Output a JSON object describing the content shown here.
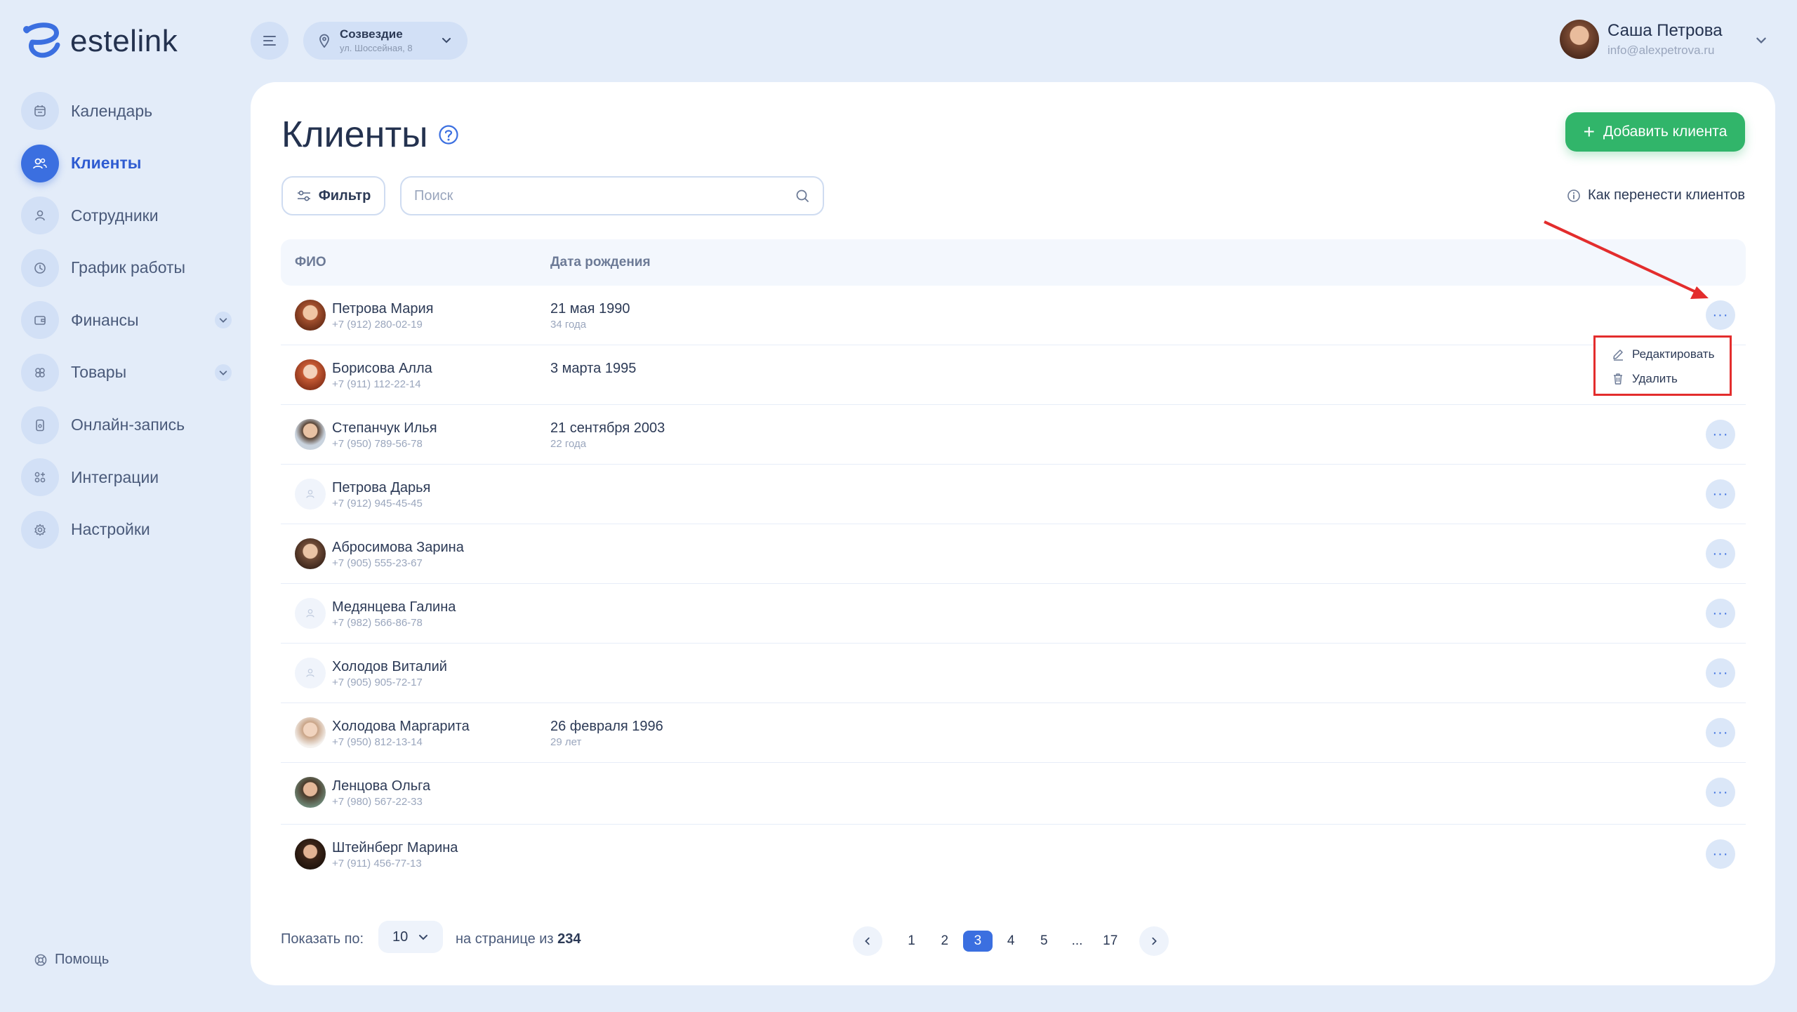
{
  "brand": {
    "name": "estelink"
  },
  "location": {
    "name": "Созвездие",
    "address": "ул. Шоссейная, 8"
  },
  "user": {
    "name": "Саша Петрова",
    "email": "info@alexpetrova.ru"
  },
  "sidebar": {
    "items": [
      {
        "label": "Календарь",
        "icon": "calendar-icon"
      },
      {
        "label": "Клиенты",
        "icon": "clients-icon",
        "active": true
      },
      {
        "label": "Сотрудники",
        "icon": "employee-icon"
      },
      {
        "label": "График работы",
        "icon": "clock-icon"
      },
      {
        "label": "Финансы",
        "icon": "wallet-icon",
        "expandable": true
      },
      {
        "label": "Товары",
        "icon": "products-icon",
        "expandable": true
      },
      {
        "label": "Онлайн-запись",
        "icon": "phone-icon"
      },
      {
        "label": "Интеграции",
        "icon": "integrations-icon"
      },
      {
        "label": "Настройки",
        "icon": "gear-icon"
      }
    ],
    "help_label": "Помощь"
  },
  "page": {
    "title": "Клиенты",
    "add_button": "Добавить клиента",
    "filter_button": "Фильтр",
    "search_placeholder": "Поиск",
    "how_to_link": "Как перенести клиентов"
  },
  "table": {
    "columns": [
      "ФИО",
      "Дата рождения"
    ],
    "rows": [
      {
        "name": "Петрова Мария",
        "phone": "+7 (912) 280-02-19",
        "birthday": "21 мая 1990",
        "age": "34 года",
        "more": "···"
      },
      {
        "name": "Борисова Алла",
        "phone": "+7 (911) 112-22-14",
        "birthday": "3 марта 1995",
        "age": "",
        "more": "···"
      },
      {
        "name": "Степанчук Илья",
        "phone": "+7 (950) 789-56-78",
        "birthday": "21 сентября 2003",
        "age": "22 года",
        "more": "···"
      },
      {
        "name": "Петрова Дарья",
        "phone": "+7 (912) 945-45-45",
        "birthday": "",
        "age": "",
        "more": "···"
      },
      {
        "name": "Абросимова Зарина",
        "phone": "+7 (905) 555-23-67",
        "birthday": "",
        "age": "",
        "more": "···"
      },
      {
        "name": "Медянцева Галина",
        "phone": "+7 (982) 566-86-78",
        "birthday": "",
        "age": "",
        "more": "···"
      },
      {
        "name": "Холодов Виталий",
        "phone": "+7 (905) 905-72-17",
        "birthday": "",
        "age": "",
        "more": "···"
      },
      {
        "name": "Холодова Маргарита",
        "phone": "+7 (950) 812-13-14",
        "birthday": "26 февраля 1996",
        "age": "29 лет",
        "more": "···"
      },
      {
        "name": "Ленцова Ольга",
        "phone": "+7 (980) 567-22-33",
        "birthday": "",
        "age": "",
        "more": "···"
      },
      {
        "name": "Штейнберг Марина",
        "phone": "+7 (911) 456-77-13",
        "birthday": "",
        "age": "",
        "more": "···"
      }
    ]
  },
  "context_menu": {
    "edit": "Редактировать",
    "delete": "Удалить"
  },
  "pagination": {
    "show_label": "Показать по:",
    "per_page": "10",
    "on_page_of": "на странице из",
    "total": "234",
    "pages": [
      "1",
      "2",
      "3",
      "4",
      "5",
      "...",
      "17"
    ],
    "current": "3"
  },
  "colors": {
    "accent": "#3b6fe0",
    "success": "#31b56a",
    "annotation": "#e32d2d",
    "background": "#e3ecf9"
  }
}
